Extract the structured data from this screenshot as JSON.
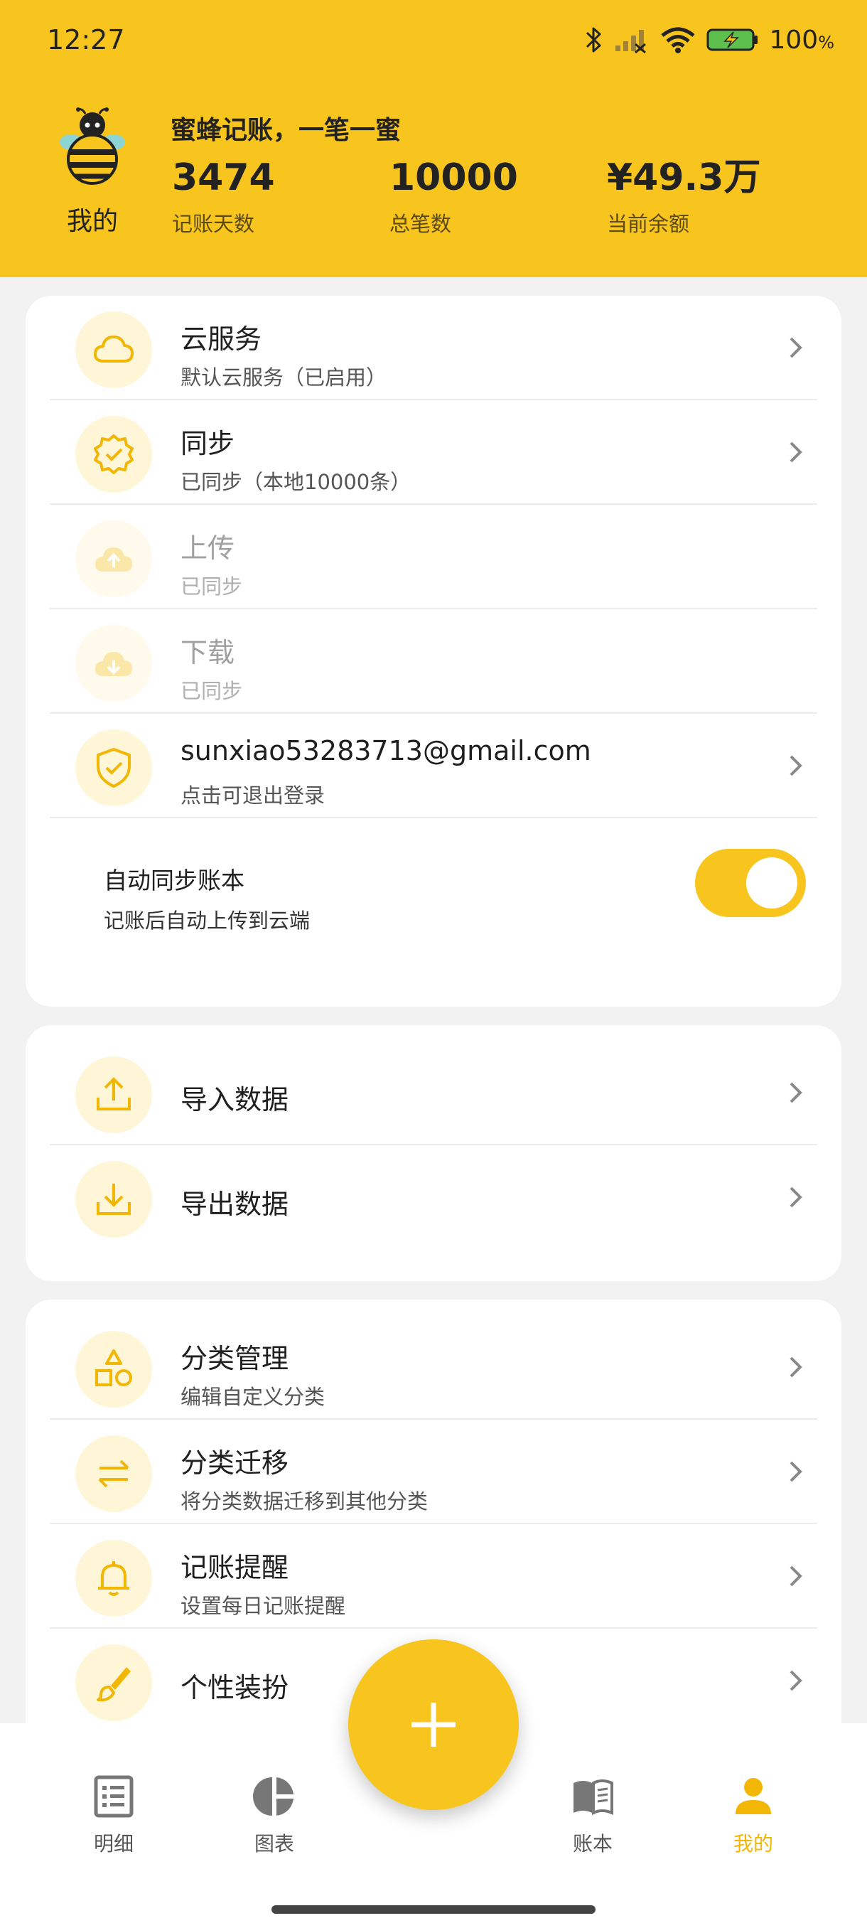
{
  "status_bar": {
    "time": "12:27",
    "battery_percent": "100",
    "battery_unit": "%",
    "icons": [
      "bluetooth-icon",
      "signal-icon",
      "wifi-icon",
      "battery-charging-icon"
    ]
  },
  "header": {
    "profile_label": "我的",
    "slogan": "蜜蜂记账，一笔一蜜",
    "stats": [
      {
        "value": "3474",
        "label": "记账天数"
      },
      {
        "value": "10000",
        "label": "总笔数"
      },
      {
        "value": "¥49.3万",
        "label": "当前余额"
      }
    ]
  },
  "cloud_section": {
    "items": [
      {
        "title": "云服务",
        "subtitle": "默认云服务（已启用）",
        "icon": "cloud-icon",
        "enabled": true
      },
      {
        "title": "同步",
        "subtitle": "已同步（本地10000条）",
        "icon": "verified-badge-icon",
        "enabled": true
      },
      {
        "title": "上传",
        "subtitle": "已同步",
        "icon": "cloud-upload-icon",
        "enabled": false
      },
      {
        "title": "下载",
        "subtitle": "已同步",
        "icon": "cloud-download-icon",
        "enabled": false
      },
      {
        "title": "sunxiao53283713@gmail.com",
        "subtitle": "点击可退出登录",
        "icon": "shield-check-icon",
        "enabled": true
      }
    ],
    "auto_sync": {
      "title": "自动同步账本",
      "subtitle": "记账后自动上传到云端",
      "on": true
    }
  },
  "data_section": {
    "items": [
      {
        "title": "导入数据",
        "icon": "import-icon"
      },
      {
        "title": "导出数据",
        "icon": "export-icon"
      }
    ]
  },
  "settings_section": {
    "items": [
      {
        "title": "分类管理",
        "subtitle": "编辑自定义分类",
        "icon": "shapes-icon"
      },
      {
        "title": "分类迁移",
        "subtitle": "将分类数据迁移到其他分类",
        "icon": "swap-arrows-icon"
      },
      {
        "title": "记账提醒",
        "subtitle": "设置每日记账提醒",
        "icon": "bell-icon"
      },
      {
        "title": "个性装扮",
        "icon": "brush-icon"
      }
    ]
  },
  "bottom_nav": {
    "items": [
      {
        "label": "明细",
        "icon": "list-icon",
        "active": false
      },
      {
        "label": "图表",
        "icon": "pie-chart-icon",
        "active": false
      },
      {
        "label": "账本",
        "icon": "book-icon",
        "active": false
      },
      {
        "label": "我的",
        "icon": "person-icon",
        "active": true
      }
    ],
    "fab_icon": "plus-icon"
  },
  "colors": {
    "brand_yellow": "#f7c51e",
    "icon_yellow": "#f2b705",
    "icon_bg": "#fff6d8",
    "background": "#f2f2f2"
  }
}
